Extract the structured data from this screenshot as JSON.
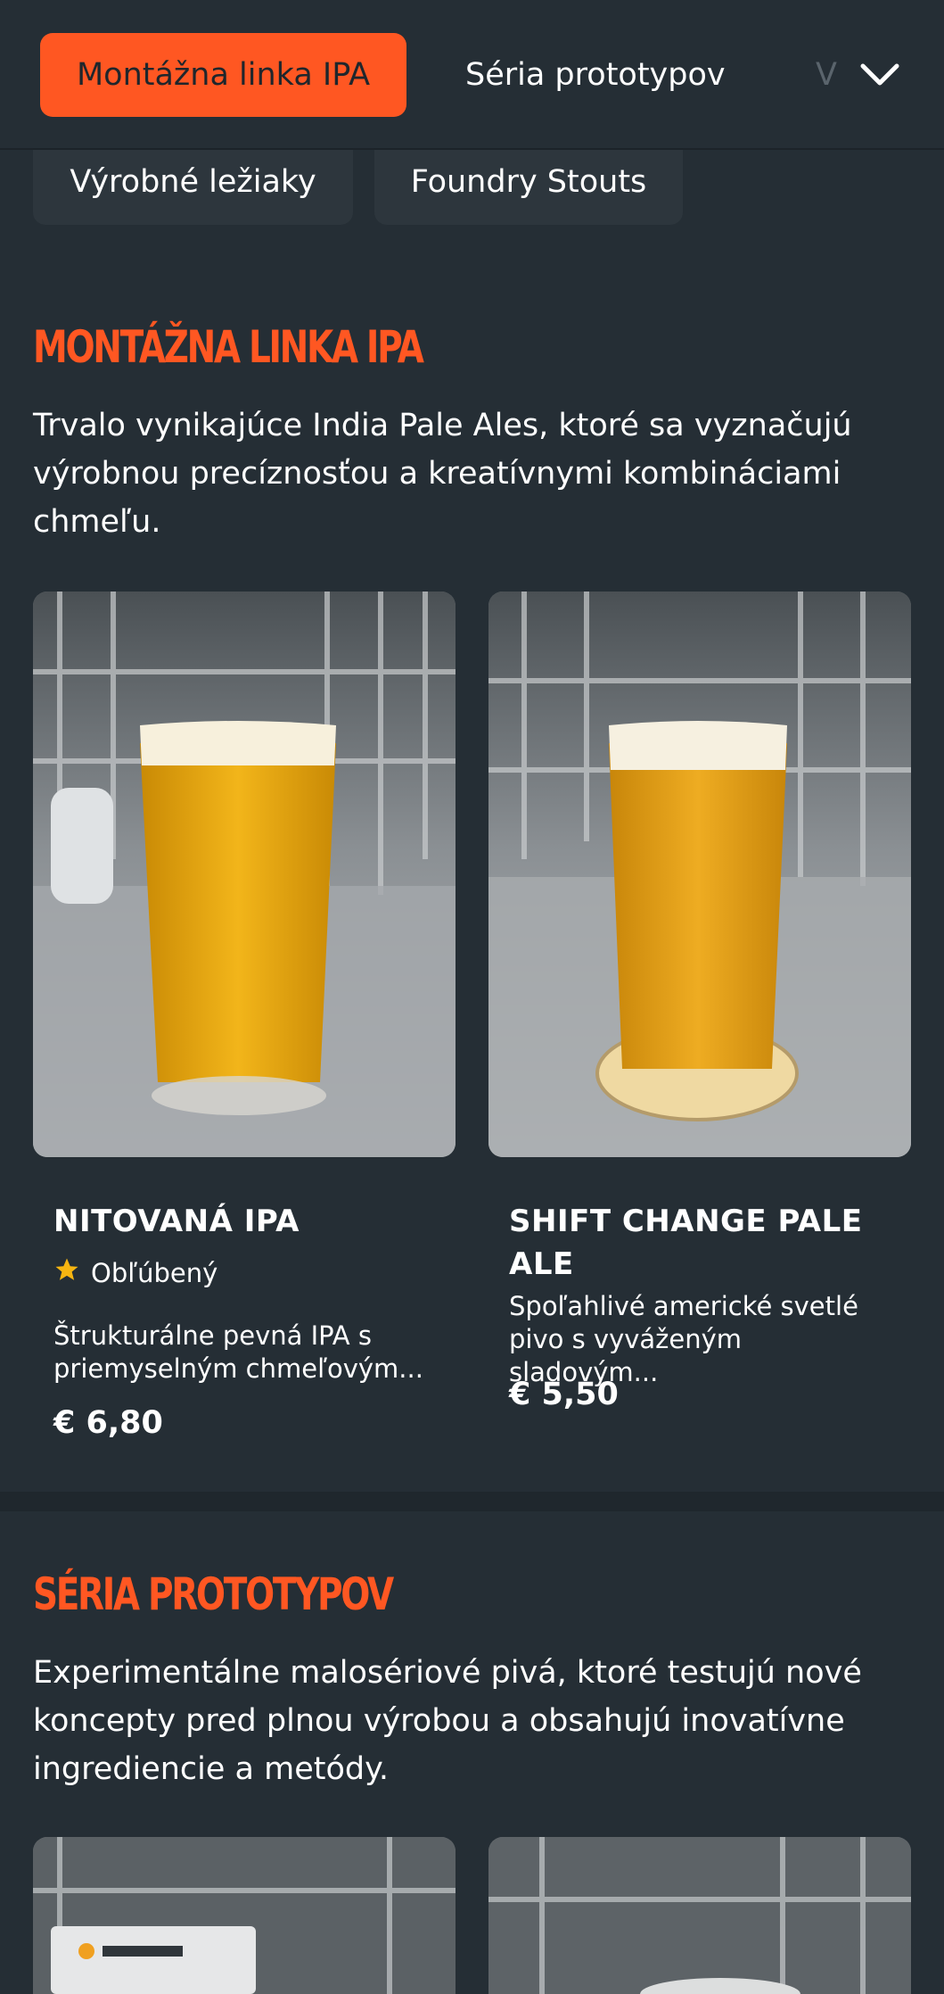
{
  "topbar": {
    "tabs": [
      {
        "label": "Montážna linka IPA",
        "active": true
      },
      {
        "label": "Séria prototypov",
        "active": false
      },
      {
        "label": "V",
        "active": false
      }
    ],
    "expand_icon": "chevron-down-icon"
  },
  "category_pills": [
    {
      "label": "Výrobné ležiaky"
    },
    {
      "label": "Foundry Stouts"
    }
  ],
  "sections": [
    {
      "title": "MONTÁŽNA LINKA IPA",
      "description": "Trvalo vynikajúce India Pale Ales, ktoré sa vyznačujú výrobnou precíznosťou a kreatívnymi kombináciami chmeľu.",
      "items": [
        {
          "name": "NITOVANÁ IPA",
          "badge": "Obľúbený",
          "badge_icon": "star-icon",
          "description": "Štrukturálne pevná IPA s priemyselným chmeľovým...",
          "price": "€ 6,80"
        },
        {
          "name_line1": "SHIFT CHANGE PALE",
          "name_line2": "ALE",
          "description": "Spoľahlivé americké svetlé pivo s vyváženým sladovým...",
          "price": "€ 5,50"
        }
      ]
    },
    {
      "title": "SÉRIA PROTOTYPOV",
      "description": "Experimentálne malosériové pivá, ktoré testujú nové koncepty pred plnou výrobou a obsahujú inovatívne ingrediencie a metódy."
    }
  ],
  "colors": {
    "accent": "#ff5722",
    "background": "#252e35",
    "star": "#f6b511"
  }
}
